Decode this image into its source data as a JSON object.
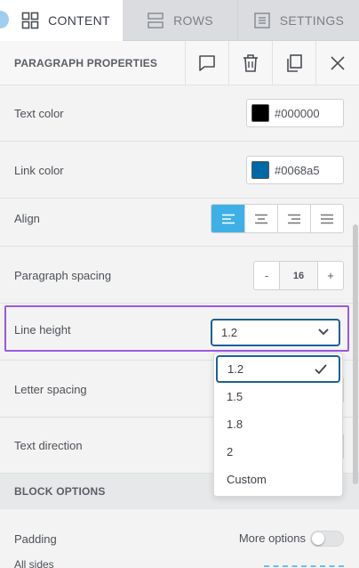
{
  "tabs": [
    {
      "label": "CONTENT",
      "icon": "grid-icon"
    },
    {
      "label": "ROWS",
      "icon": "rows-icon"
    },
    {
      "label": "SETTINGS",
      "icon": "settings-list-icon"
    }
  ],
  "properties": {
    "title": "PARAGRAPH PROPERTIES",
    "actions": [
      "comment-icon",
      "trash-icon",
      "duplicate-icon",
      "close-icon"
    ]
  },
  "text_color": {
    "label": "Text color",
    "value": "#000000",
    "swatch": "#000000"
  },
  "link_color": {
    "label": "Link color",
    "value": "#0068a5",
    "swatch": "#0068a5"
  },
  "align": {
    "label": "Align",
    "options": [
      "left",
      "center",
      "right",
      "justify"
    ],
    "selected": "left"
  },
  "paragraph_spacing": {
    "label": "Paragraph spacing",
    "minus": "-",
    "value": "16",
    "plus": "+"
  },
  "line_height": {
    "label": "Line height",
    "value": "1.2",
    "options": [
      "1.2",
      "1.5",
      "1.8",
      "2",
      "Custom"
    ],
    "selected_index": 0
  },
  "letter_spacing": {
    "label": "Letter spacing"
  },
  "text_direction": {
    "label": "Text direction"
  },
  "block_options": {
    "title": "BLOCK OPTIONS"
  },
  "padding": {
    "label": "Padding",
    "more_options": "More options",
    "all_sides": "All sides",
    "more_options_enabled": false
  },
  "colors": {
    "accent": "#3fb0e6",
    "focus": "#1f5f97",
    "highlight": "#9b59e0"
  }
}
